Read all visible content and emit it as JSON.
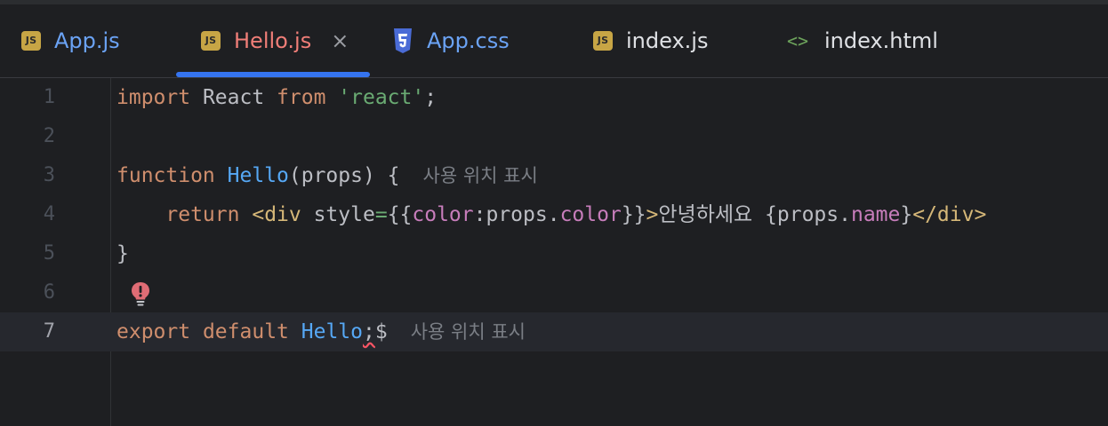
{
  "tabs": [
    {
      "label": "App.js",
      "icon": "js-file-icon",
      "badge": "JS"
    },
    {
      "label": "Hello.js",
      "icon": "js-file-icon",
      "badge": "JS",
      "active": true
    },
    {
      "label": "App.css",
      "icon": "css-file-icon"
    },
    {
      "label": "index.js",
      "icon": "js-file-icon",
      "badge": "JS"
    },
    {
      "label": "index.html",
      "icon": "html-file-icon",
      "glyph": "<>"
    }
  ],
  "close_glyph": "×",
  "lines": [
    {
      "n": "1",
      "tokens": [
        "import",
        " React ",
        "from",
        " ",
        "'react'",
        ";"
      ]
    },
    {
      "n": "2"
    },
    {
      "n": "3",
      "tokens": [
        "function",
        " ",
        "Hello",
        "(props) {"
      ],
      "hint": "사용 위치 표시"
    },
    {
      "n": "4",
      "tokens": [
        "    ",
        "return",
        " ",
        "<div",
        " style",
        "=",
        "{{",
        "color",
        ":props.",
        "color",
        "}}",
        ">",
        "안녕하세요 {props.",
        "name",
        "}",
        "</div>"
      ]
    },
    {
      "n": "5",
      "tokens": [
        "}"
      ]
    },
    {
      "n": "6"
    },
    {
      "n": "7",
      "tokens": [
        "export",
        " ",
        "default",
        " ",
        "Hello",
        ";",
        "$"
      ],
      "hint": "사용 위치 표시"
    }
  ],
  "colors": {
    "accent": "#3574f0",
    "keyword": "#cf8e6d",
    "string": "#6aab73",
    "function": "#56a8f5",
    "tag": "#d5b778",
    "property": "#c77dbb",
    "error": "#f75464"
  },
  "icons": {
    "gutter_line6": "error-bulb-icon"
  }
}
